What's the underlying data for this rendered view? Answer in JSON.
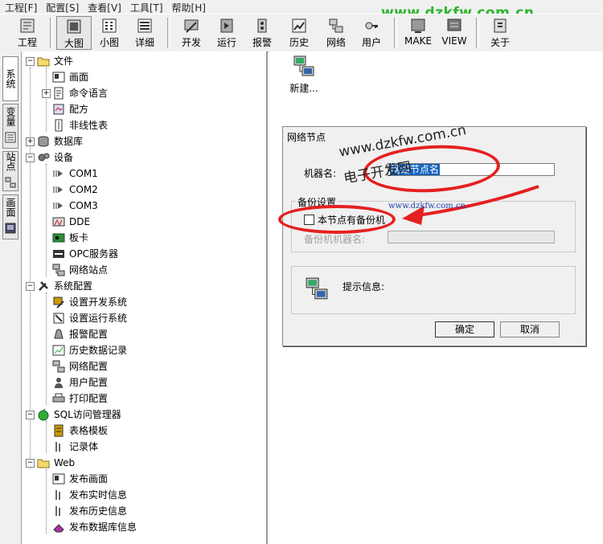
{
  "menu": [
    "工程[F]",
    "配置[S]",
    "查看[V]",
    "工具[T]",
    "帮助[H]"
  ],
  "toolbar": {
    "buttons": [
      {
        "label": "工程",
        "icon": "project-icon"
      },
      {
        "label": "大图",
        "icon": "large-icons-icon"
      },
      {
        "label": "小图",
        "icon": "small-icons-icon"
      },
      {
        "label": "详细",
        "icon": "details-icon"
      },
      {
        "label": "开发",
        "icon": "develop-icon"
      },
      {
        "label": "运行",
        "icon": "run-icon"
      },
      {
        "label": "报警",
        "icon": "alarm-icon"
      },
      {
        "label": "历史",
        "icon": "history-icon"
      },
      {
        "label": "网络",
        "icon": "network-icon"
      },
      {
        "label": "用户",
        "icon": "user-icon"
      },
      {
        "label": "MAKE",
        "icon": "make-icon"
      },
      {
        "label": "VIEW",
        "icon": "view-icon"
      },
      {
        "label": "关于",
        "icon": "about-icon"
      }
    ]
  },
  "watermark": {
    "top": "www.dzkfw.com.cn",
    "mid1": "www.dzkfw.com.cn",
    "mid2": "电子开发网",
    "small": "www.dzkfw.com.cn"
  },
  "side_tabs": [
    "系统",
    "变量",
    "站点",
    "画面"
  ],
  "tree": [
    {
      "label": "文件",
      "level": 0,
      "expander": "-",
      "icon": "folder-icon"
    },
    {
      "label": "画面",
      "level": 1,
      "icon": "screen-icon"
    },
    {
      "label": "命令语言",
      "level": 1,
      "expander": "+",
      "icon": "script-icon"
    },
    {
      "label": "配方",
      "level": 1,
      "icon": "recipe-icon"
    },
    {
      "label": "非线性表",
      "level": 1,
      "icon": "table-icon"
    },
    {
      "label": "数据库",
      "level": 0,
      "expander": "+",
      "icon": "database-icon"
    },
    {
      "label": "设备",
      "level": 0,
      "expander": "-",
      "icon": "device-icon"
    },
    {
      "label": "COM1",
      "level": 1,
      "icon": "com-port-icon"
    },
    {
      "label": "COM2",
      "level": 1,
      "icon": "com-port-icon"
    },
    {
      "label": "COM3",
      "level": 1,
      "icon": "com-port-icon"
    },
    {
      "label": "DDE",
      "level": 1,
      "icon": "dde-icon"
    },
    {
      "label": "板卡",
      "level": 1,
      "icon": "board-icon"
    },
    {
      "label": "OPC服务器",
      "level": 1,
      "icon": "opc-icon"
    },
    {
      "label": "网络站点",
      "level": 1,
      "icon": "network-node-icon"
    },
    {
      "label": "系统配置",
      "level": 0,
      "expander": "-",
      "icon": "tools-icon"
    },
    {
      "label": "设置开发系统",
      "level": 1,
      "icon": "dev-settings-icon"
    },
    {
      "label": "设置运行系统",
      "level": 1,
      "icon": "run-settings-icon"
    },
    {
      "label": "报警配置",
      "level": 1,
      "icon": "alarm-config-icon"
    },
    {
      "label": "历史数据记录",
      "level": 1,
      "icon": "history-record-icon"
    },
    {
      "label": "网络配置",
      "level": 1,
      "icon": "network-config-icon"
    },
    {
      "label": "用户配置",
      "level": 1,
      "icon": "user-config-icon"
    },
    {
      "label": "打印配置",
      "level": 1,
      "icon": "printer-icon"
    },
    {
      "label": "SQL访问管理器",
      "level": 0,
      "expander": "-",
      "icon": "sql-icon"
    },
    {
      "label": "表格模板",
      "level": 1,
      "icon": "template-icon"
    },
    {
      "label": "记录体",
      "level": 1,
      "icon": "record-icon"
    },
    {
      "label": "Web",
      "level": 0,
      "expander": "-",
      "icon": "folder-icon"
    },
    {
      "label": "发布画面",
      "level": 1,
      "icon": "screen-icon"
    },
    {
      "label": "发布实时信息",
      "level": 1,
      "icon": "record-icon"
    },
    {
      "label": "发布历史信息",
      "level": 1,
      "icon": "record-icon"
    },
    {
      "label": "发布数据库信息",
      "level": 1,
      "icon": "eraser-icon"
    }
  ],
  "content": {
    "new_item_label": "新建..."
  },
  "dialog": {
    "title": "网络节点",
    "machine_name_label": "机器名:",
    "machine_name_value": "网络节点名",
    "backup_group_label": "备份设置",
    "backup_checkbox_label": "本节点有备份机",
    "backup_checked": false,
    "backup_machine_label": "备份机机器名:",
    "backup_machine_value": "",
    "hint_label": "提示信息:",
    "ok_label": "确定",
    "cancel_label": "取消"
  },
  "colors": {
    "accent_red": "#e52020",
    "watermark_green": "#2db52d",
    "selection_blue": "#1565c0"
  }
}
